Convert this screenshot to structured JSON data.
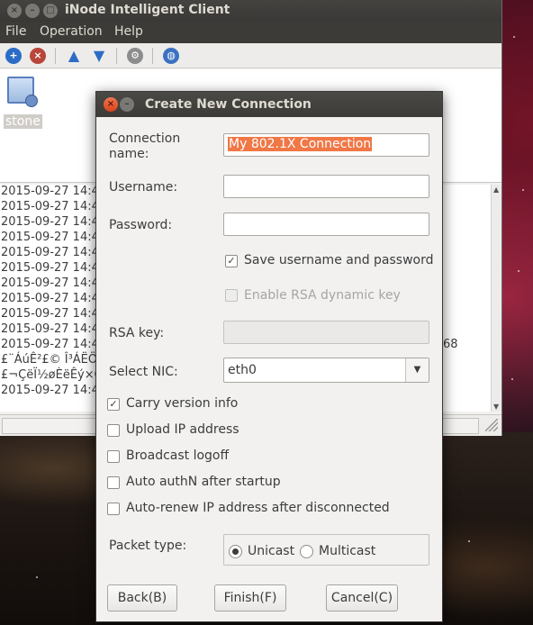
{
  "main_window": {
    "title": "iNode Intelligent Client",
    "menu": [
      "File",
      "Operation",
      "Help"
    ],
    "connection_label": "stone",
    "log_lines": [
      "2015-09-27 14:4",
      "2015-09-27 14:4",
      "2015-09-27 14:4",
      "2015-09-27 14:4",
      "2015-09-27 14:4",
      "2015-09-27 14:4",
      "2015-09-27 14:4",
      "2015-09-27 14:4",
      "2015-09-27 14:4",
      "2015-09-27 14:4",
      "2015-09-27 14:4",
      "£¨ÁúÊ²£© Î³ÁËÖ",
      "£¬ÇëÏ½øÈëÊý×Ö",
      "2015-09-27 14:4"
    ],
    "log_tail_fragment": "68"
  },
  "dialog": {
    "title": "Create New Connection",
    "connection_name_label": "Connection name:",
    "connection_name_value": "My 802.1X Connection",
    "username_label": "Username:",
    "username_value": "",
    "password_label": "Password:",
    "password_value": "",
    "save_credentials_label": "Save username and password",
    "save_credentials_checked": true,
    "rsa_dynamic_label": "Enable RSA dynamic key",
    "rsa_dynamic_checked": false,
    "rsa_key_label": "RSA key:",
    "rsa_key_value": "",
    "select_nic_label": "Select NIC:",
    "select_nic_value": "eth0",
    "options": [
      {
        "label": "Carry version info",
        "checked": true
      },
      {
        "label": "Upload IP address",
        "checked": false
      },
      {
        "label": "Broadcast logoff",
        "checked": false
      },
      {
        "label": "Auto authN after startup",
        "checked": false
      },
      {
        "label": "Auto-renew IP address after disconnected",
        "checked": false
      }
    ],
    "packet_type_label": "Packet type:",
    "packet_types": [
      {
        "label": "Unicast",
        "selected": true
      },
      {
        "label": "Multicast",
        "selected": false
      }
    ],
    "buttons": {
      "back": "Back(B)",
      "finish": "Finish(F)",
      "cancel": "Cancel(C)"
    }
  },
  "colors": {
    "selection": "#f07746",
    "titlebar": "#3c3b37",
    "window_bg": "#f2f1f0"
  }
}
